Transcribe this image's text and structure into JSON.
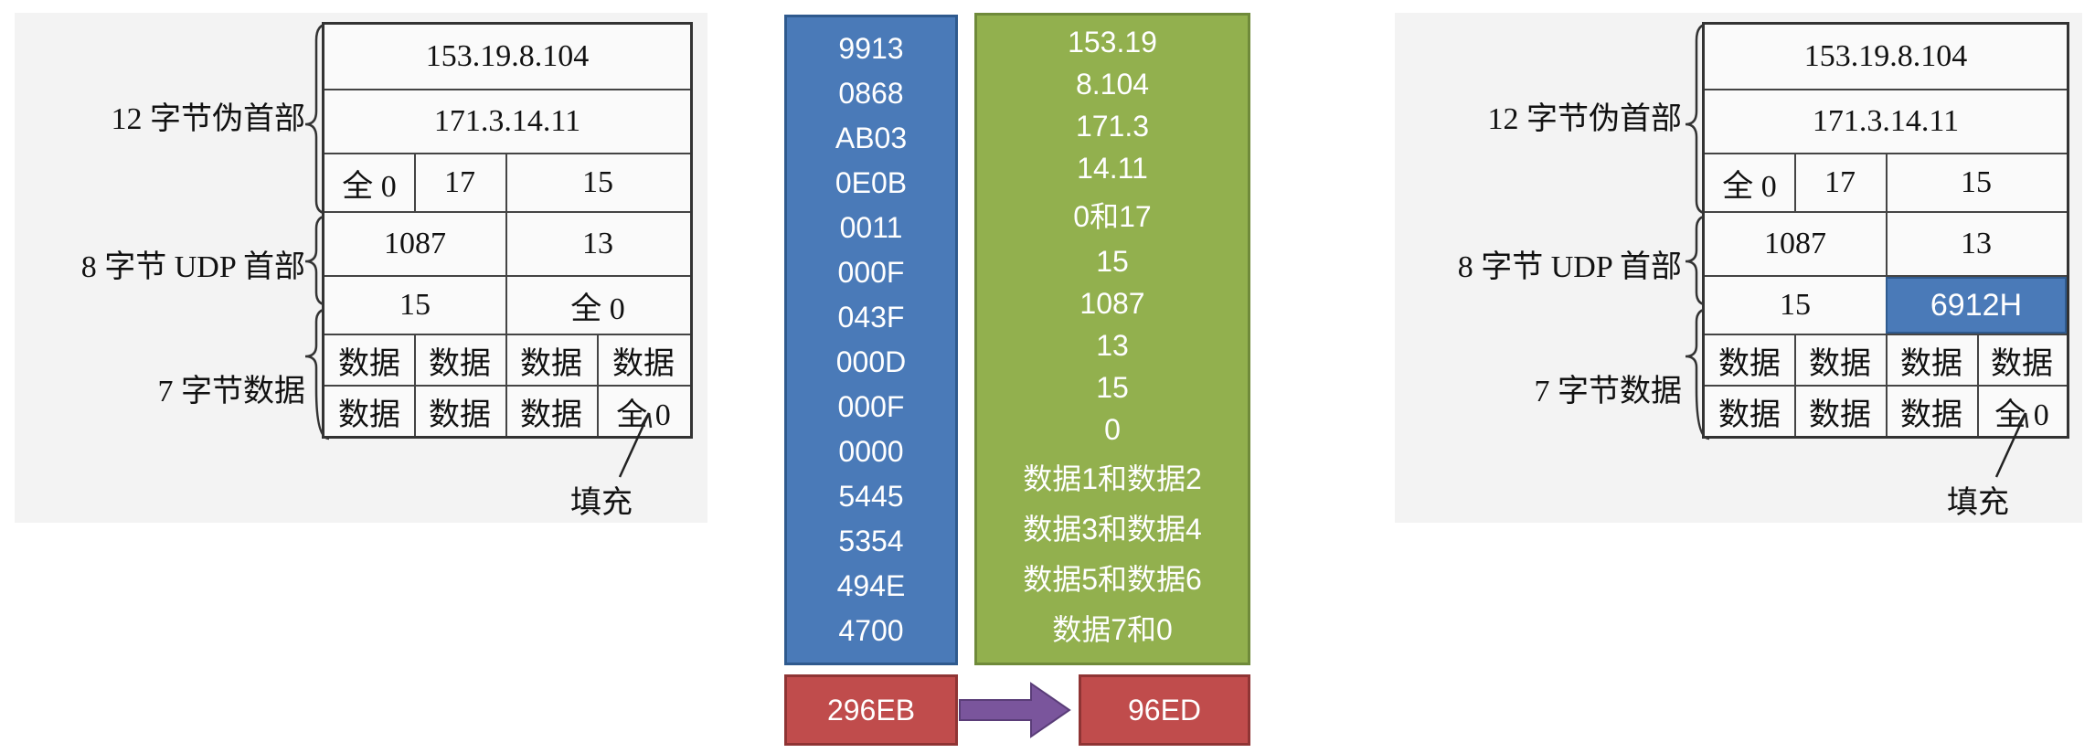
{
  "left_diagram": {
    "labels": {
      "pseudo": "12 字节伪首部",
      "udp": "8 字节 UDP 首部",
      "data": "7 字节数据",
      "pad": "填充"
    },
    "rows": {
      "src_ip": "153.19.8.104",
      "dst_ip": "171.3.14.11",
      "zero": "全 0",
      "proto": "17",
      "len": "15",
      "src_port": "1087",
      "dst_port": "13",
      "udp_len": "15",
      "checksum": "全 0",
      "data": "数据",
      "pad_zero": "全 0"
    }
  },
  "right_diagram": {
    "labels": {
      "pseudo": "12 字节伪首部",
      "udp": "8 字节 UDP 首部",
      "data": "7 字节数据",
      "pad": "填充"
    },
    "rows": {
      "src_ip": "153.19.8.104",
      "dst_ip": "171.3.14.11",
      "zero": "全 0",
      "proto": "17",
      "len": "15",
      "src_port": "1087",
      "dst_port": "13",
      "udp_len": "15",
      "checksum": "6912H",
      "data": "数据",
      "pad_zero": "全 0"
    }
  },
  "hex_words": [
    "9913",
    "0868",
    "AB03",
    "0E0B",
    "0011",
    "000F",
    "043F",
    "000D",
    "000F",
    "0000",
    "5445",
    "5354",
    "494E",
    "4700"
  ],
  "decimal_values": [
    "153.19",
    "8.104",
    "171.3",
    "14.11",
    "0和17",
    "15",
    "1087",
    "13",
    "15",
    "0",
    "数据1和数据2",
    "数据3和数据4",
    "数据5和数据6",
    "数据7和0"
  ],
  "sum_raw": "296EB",
  "sum_folded": "96ED",
  "colors": {
    "blue": "#4a7ab8",
    "green": "#92b04e",
    "red": "#c04c4c",
    "arrow": "#7a559c"
  }
}
